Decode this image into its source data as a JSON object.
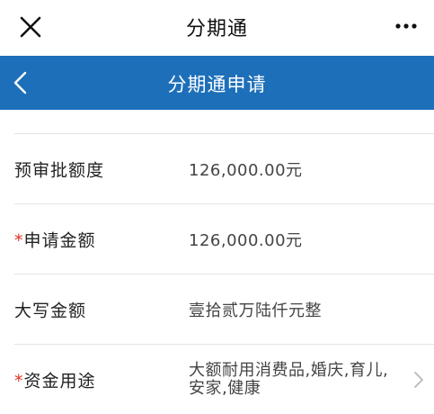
{
  "topbar": {
    "title": "分期通",
    "close_icon": "close-icon",
    "more_icon": "more-icon"
  },
  "navbar": {
    "title": "分期通申请",
    "back_icon": "back-chevron-icon",
    "background": "#1d6fba"
  },
  "form": {
    "rows": [
      {
        "label": "预审批额度",
        "required": false,
        "value": "126,000.00元"
      },
      {
        "label": "申请金额",
        "required": true,
        "value": "126,000.00元"
      },
      {
        "label": "大写金额",
        "required": false,
        "value": "壹拾贰万陆仟元整"
      },
      {
        "label": "资金用途",
        "required": true,
        "value": "大额耐用消费品,婚庆,育儿,安家,健康"
      }
    ],
    "required_mark": "*",
    "required_color": "#e0301e"
  }
}
